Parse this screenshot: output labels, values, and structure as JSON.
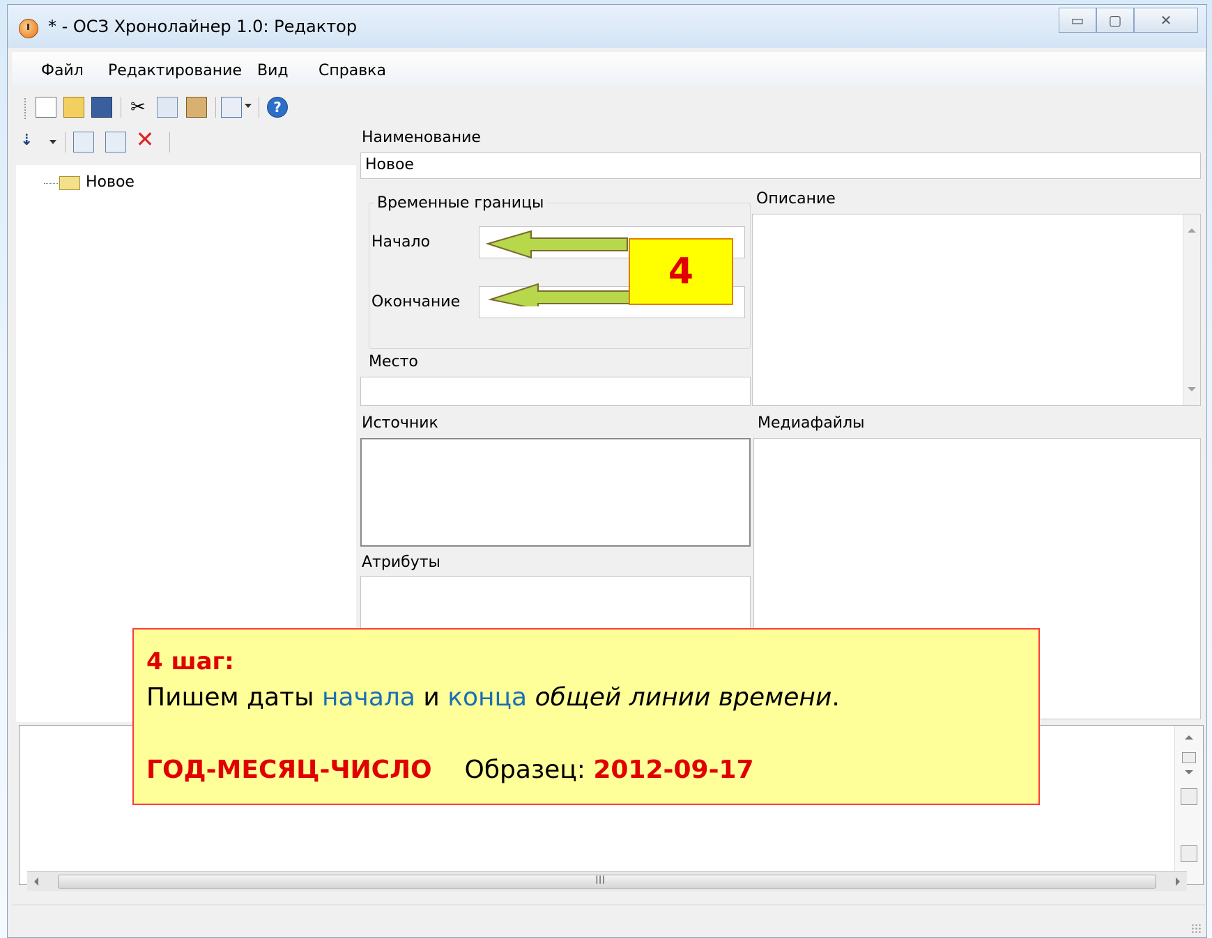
{
  "window": {
    "title": "* - ОСЗ Хронолайнер 1.0: Редактор",
    "buttons": {
      "minimize": "▭",
      "maximize": "▢",
      "close": "✕"
    }
  },
  "menu": [
    "Файл",
    "Редактирование",
    "Вид",
    "Справка"
  ],
  "toolbar_icons": [
    "new-file-icon",
    "open-folder-icon",
    "save-icon",
    "cut-icon",
    "copy-icon",
    "paste-icon",
    "view-grid-icon",
    "help-icon"
  ],
  "tree_toolbar_icons": [
    "sort-icon",
    "add-item-icon",
    "add-subitem-icon",
    "delete-icon"
  ],
  "tree": {
    "root": "Новое"
  },
  "form": {
    "name_label": "Наименование",
    "name_value": "Новое",
    "time_group_label": "Временные границы",
    "start_label": "Начало",
    "start_value": "",
    "end_label": "Окончание",
    "end_value": "",
    "place_label": "Место",
    "place_value": "",
    "description_label": "Описание",
    "source_label": "Источник",
    "media_label": "Медиафайлы",
    "attributes_label": "Атрибуты"
  },
  "hscroll_grip": "III",
  "callout_number": "4",
  "note": {
    "step": "4 шаг:",
    "line_a": "Пишем даты ",
    "word_start": "начала",
    "line_b": " и ",
    "word_end": "конца",
    "line_c": " ",
    "italic_part": "общей линии времени",
    "line_d": ".",
    "format": "ГОД-МЕСЯЦ-ЧИСЛО",
    "example_label": "Образец: ",
    "example_value": "2012-09-17"
  },
  "colors": {
    "note_background": "#ffff99",
    "note_border": "#ff3b3b",
    "accent_red": "#e00000",
    "accent_blue": "#1a6fb5",
    "arrow_fill": "#b6d84a",
    "callout_background": "#ffff00"
  }
}
